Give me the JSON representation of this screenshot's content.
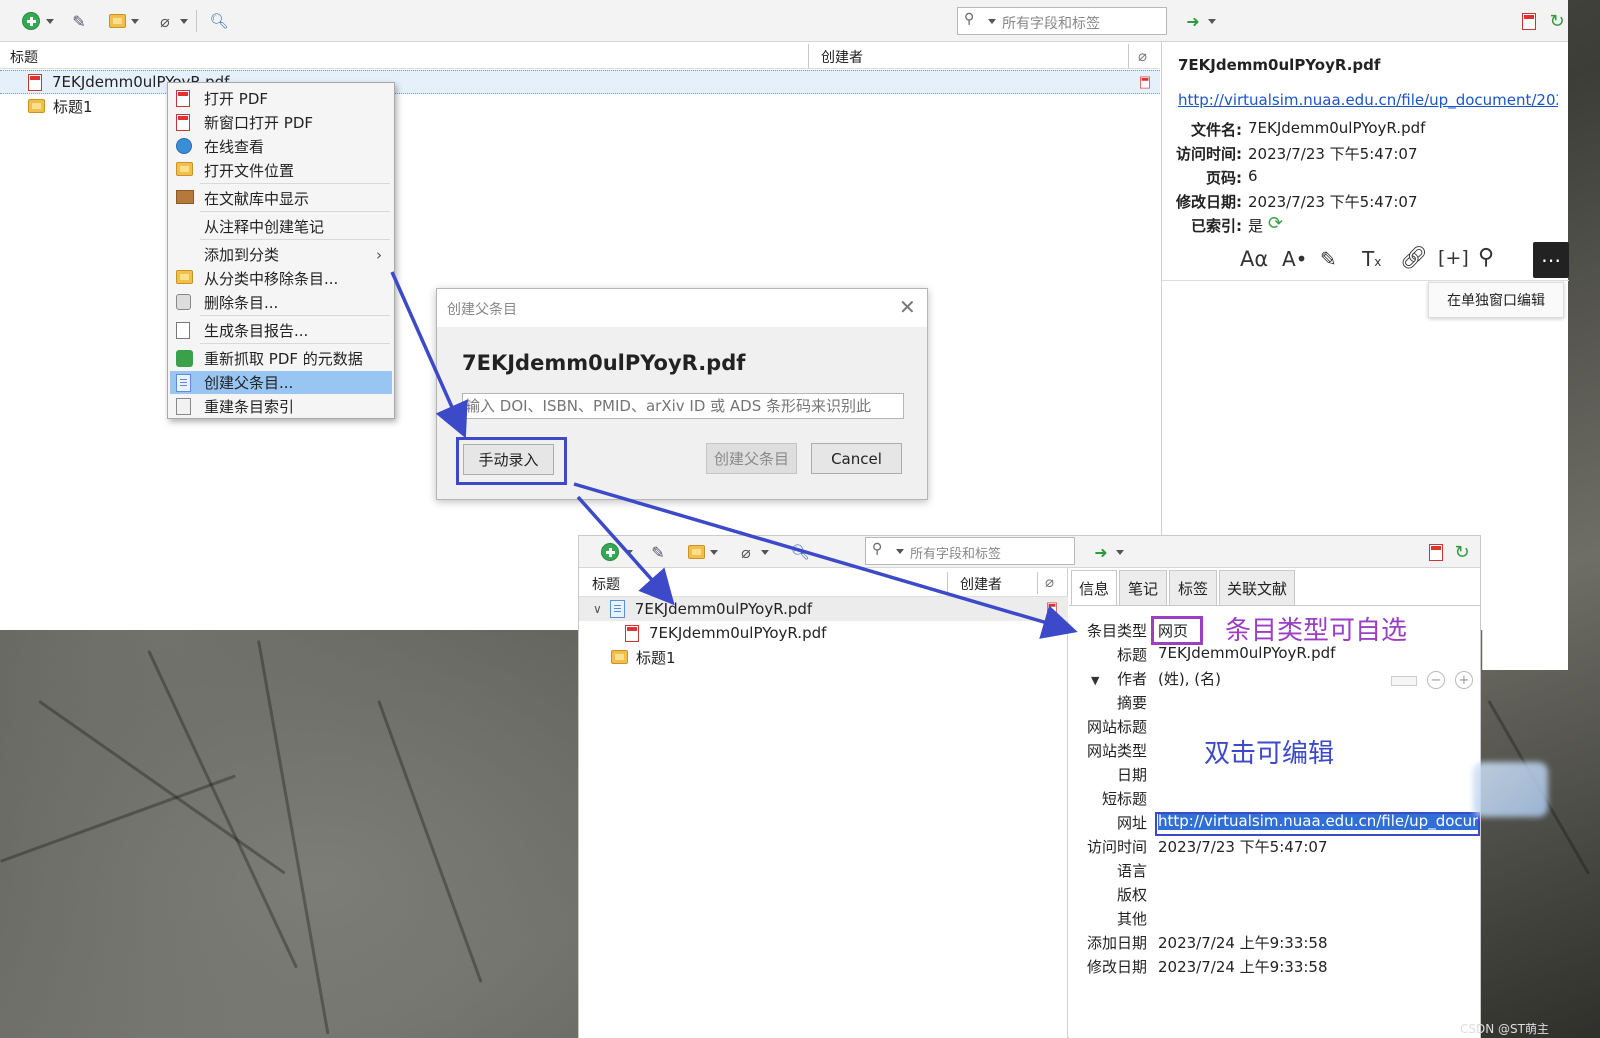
{
  "colors": {
    "accent": "#3c49c8",
    "highlight": "#98c5f2",
    "annotation_purple": "#9b3fc3"
  },
  "top_window": {
    "search": {
      "placeholder": "所有字段和标签"
    },
    "columns": {
      "title": "标题",
      "creator": "创建者"
    },
    "items": [
      {
        "label": "7EKJdemm0ulPYoyR.pdf",
        "icon": "pdf-icon"
      },
      {
        "label": "标题1",
        "icon": "folder-icon"
      }
    ]
  },
  "context_menu": {
    "items": [
      {
        "label": "打开 PDF",
        "icon": "pdf-icon"
      },
      {
        "label": "新窗口打开 PDF",
        "icon": "pdf-icon"
      },
      {
        "label": "在线查看",
        "icon": "globe-icon"
      },
      {
        "label": "打开文件位置",
        "icon": "folder-open-icon"
      },
      {
        "label": "在文献库中显示",
        "icon": "library-icon"
      },
      {
        "label": "从注释中创建笔记",
        "icon": ""
      },
      {
        "label": "添加到分类",
        "icon": "",
        "submenu": "›"
      },
      {
        "label": "从分类中移除条目...",
        "icon": "folder-remove-icon"
      },
      {
        "label": "删除条目...",
        "icon": "trash-icon"
      },
      {
        "label": "生成条目报告...",
        "icon": "report-icon"
      },
      {
        "label": "重新抓取 PDF 的元数据",
        "icon": "puzzle-icon"
      },
      {
        "label": "创建父条目...",
        "icon": "create-parent-icon",
        "highlighted": true
      },
      {
        "label": "重建条目索引",
        "icon": "reindex-icon"
      }
    ]
  },
  "dialog": {
    "title": "创建父条目",
    "filename": "7EKJdemm0ulPYoyR.pdf",
    "input_placeholder": "输入 DOI、ISBN、PMID、arXiv ID 或 ADS 条形码来识别此",
    "manual_button": "手动录入",
    "create_button": "创建父条目",
    "cancel_button": "Cancel"
  },
  "attachment_pane": {
    "filename_title": "7EKJdemm0ulPYoyR.pdf",
    "url": "http://virtualsim.nuaa.edu.cn/file/up_document/202...",
    "fields": [
      {
        "label": "文件名:",
        "value": "7EKJdemm0ulPYoyR.pdf"
      },
      {
        "label": "访问时间:",
        "value": "2023/7/23 下午5:47:07"
      },
      {
        "label": "页码:",
        "value": "6"
      },
      {
        "label": "修改日期:",
        "value": "2023/7/23 下午5:47:07"
      },
      {
        "label": "已索引:",
        "value": "是"
      }
    ],
    "tooltip": "在单独窗口编辑"
  },
  "bottom_window": {
    "search": {
      "placeholder": "所有字段和标签"
    },
    "columns": {
      "title": "标题",
      "creator": "创建者"
    },
    "items": [
      {
        "label": "7EKJdemm0ulPYoyR.pdf",
        "icon": "document-icon"
      },
      {
        "label": "7EKJdemm0ulPYoyR.pdf",
        "icon": "pdf-icon"
      },
      {
        "label": "标题1",
        "icon": "folder-icon"
      }
    ],
    "tabs": [
      "信息",
      "笔记",
      "标签",
      "关联文献"
    ],
    "fields": [
      {
        "label": "条目类型",
        "value": "网页"
      },
      {
        "label": "标题",
        "value": "7EKJdemm0ulPYoyR.pdf"
      },
      {
        "label": "作者",
        "value": "(姓), (名)"
      },
      {
        "label": "摘要",
        "value": ""
      },
      {
        "label": "网站标题",
        "value": ""
      },
      {
        "label": "网站类型",
        "value": ""
      },
      {
        "label": "日期",
        "value": ""
      },
      {
        "label": "短标题",
        "value": ""
      },
      {
        "label": "网址",
        "value": "http://virtualsim.nuaa.edu.cn/file/up_docume"
      },
      {
        "label": "访问时间",
        "value": "2023/7/23 下午5:47:07"
      },
      {
        "label": "语言",
        "value": ""
      },
      {
        "label": "版权",
        "value": ""
      },
      {
        "label": "其他",
        "value": ""
      },
      {
        "label": "添加日期",
        "value": "2023/7/24 上午9:33:58"
      },
      {
        "label": "修改日期",
        "value": "2023/7/24 上午9:33:58"
      }
    ]
  },
  "annotations": {
    "type_selectable": "条目类型可自选",
    "double_click_edit": "双击可编辑"
  },
  "watermark": "CSDN @ST萌主"
}
